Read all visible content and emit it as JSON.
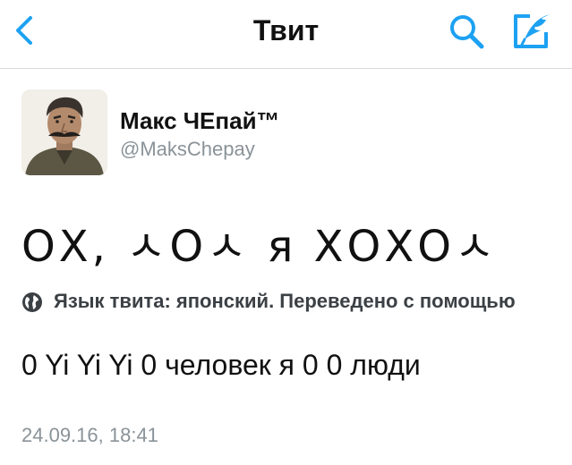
{
  "navbar": {
    "title": "Твит",
    "back_icon": "chevron-left-icon",
    "search_icon": "search-icon",
    "compose_icon": "compose-tweet-icon",
    "accent_color": "#1da1f2"
  },
  "tweet": {
    "author_name": "Макс ЧЕпай™",
    "author_handle": "@MaksChepay",
    "text": "ОХ, ㅅОㅅ я ХОХОㅅ",
    "translation_label": "Язык твита: японский. Переведено с помощью",
    "translated_text": "0 Yi Yi Yi 0 человек я 0 0 люди",
    "timestamp": "24.09.16, 18:41"
  }
}
